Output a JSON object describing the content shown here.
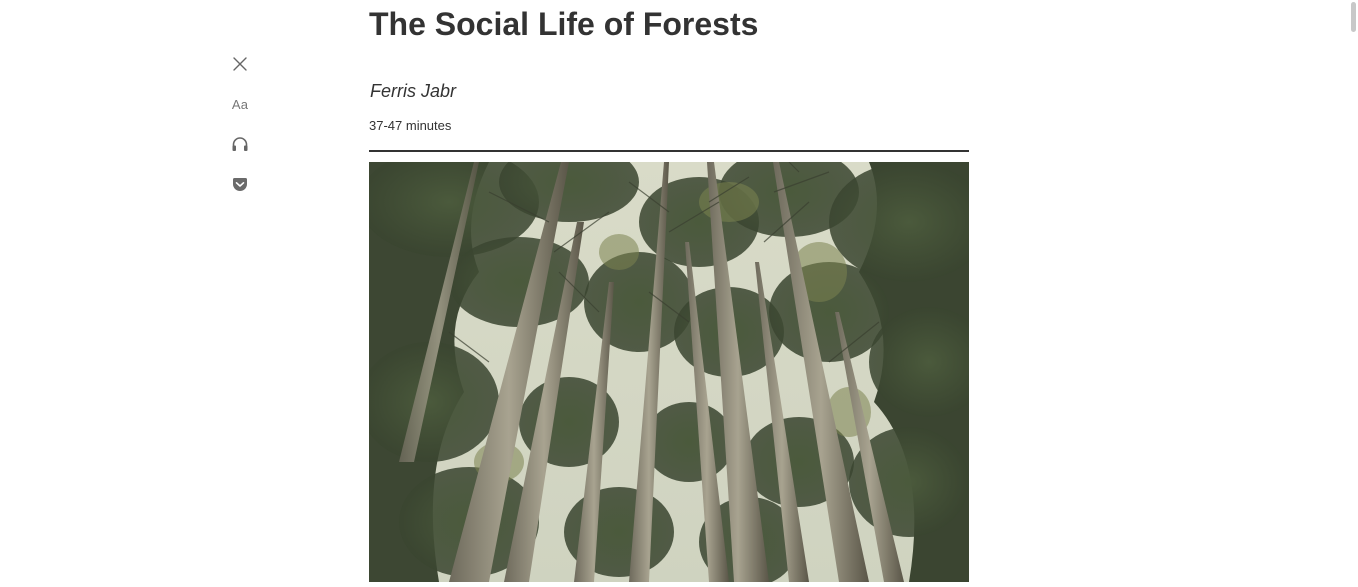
{
  "toolbar": {
    "items": [
      {
        "name": "close-button",
        "icon": "close-icon"
      },
      {
        "name": "text-settings-button",
        "icon": "text-size-icon",
        "label": "Aa"
      },
      {
        "name": "listen-button",
        "icon": "headphones-icon"
      },
      {
        "name": "save-to-pocket-button",
        "icon": "pocket-icon"
      }
    ]
  },
  "article": {
    "title": "The Social Life of Forests",
    "author": "Ferris Jabr",
    "reading_time": "37-47 minutes",
    "hero_image": "forest-canopy-photo"
  },
  "colors": {
    "text": "#333333",
    "icon": "#666666",
    "sky": "#d6d8c4",
    "foliage": "#3f4a34"
  }
}
